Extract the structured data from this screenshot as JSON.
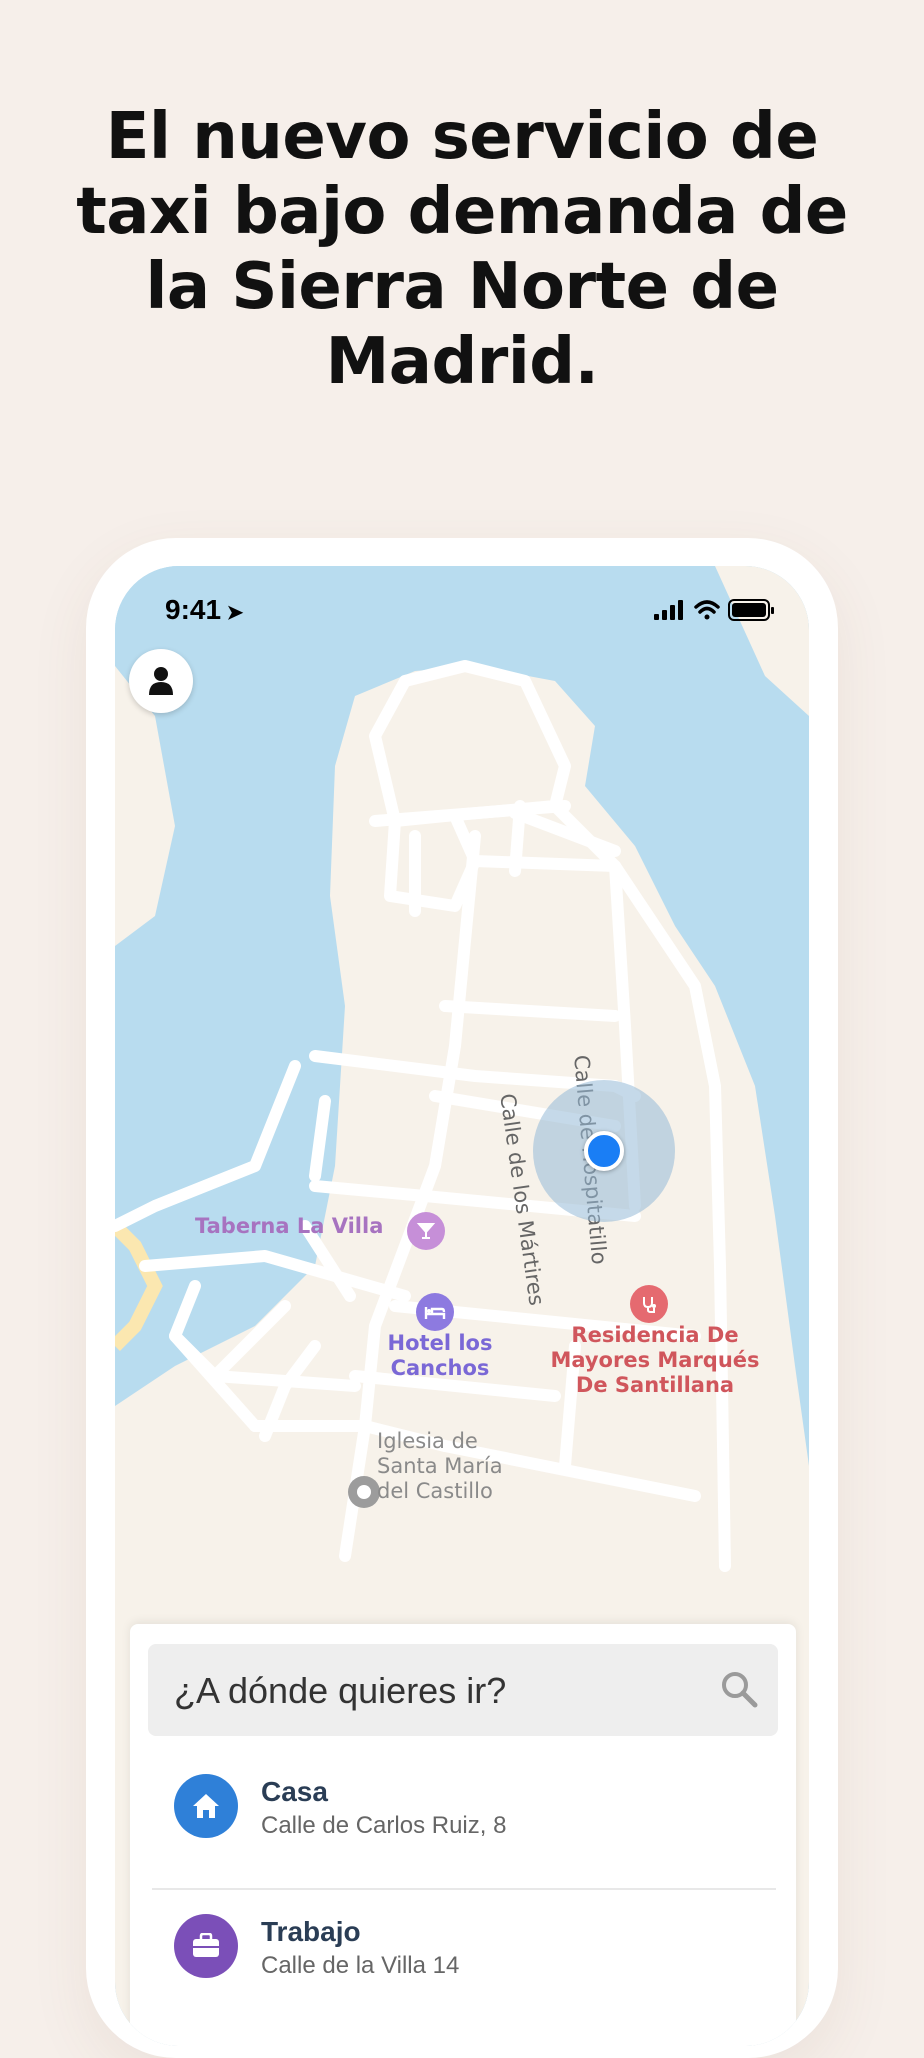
{
  "headline": "El nuevo servicio de\ntaxi bajo demanda de\nla Sierra Norte de\nMadrid.",
  "status_bar": {
    "time": "9:41"
  },
  "map": {
    "pois": [
      {
        "name": "Taberna La Villa",
        "icon": "cocktail-icon"
      },
      {
        "name": "Hotel los\nCanchos",
        "icon": "bed-icon"
      },
      {
        "name": "Residencia De\nMayores Marqués\nDe Santillana",
        "icon": "stethoscope-icon"
      },
      {
        "name": "Iglesia de\nSanta María\ndel Castillo",
        "icon": "circle-marker-icon"
      }
    ],
    "streets": [
      "Calle de los Mártires",
      "Calle de Hospitatillo"
    ]
  },
  "search": {
    "placeholder": "¿A dónde quieres ir?"
  },
  "saved_places": [
    {
      "title": "Casa",
      "address": "Calle de Carlos Ruiz, 8",
      "icon": "home-icon",
      "color": "#2f80d8"
    },
    {
      "title": "Trabajo",
      "address": "Calle de la Villa 14",
      "icon": "briefcase-icon",
      "color": "#7b4fb8"
    }
  ],
  "colors": {
    "water": "#b8dcef",
    "land": "#f7f2ea",
    "road": "#ffffff",
    "location": "#1a7ef5",
    "background": "#f6efea"
  }
}
